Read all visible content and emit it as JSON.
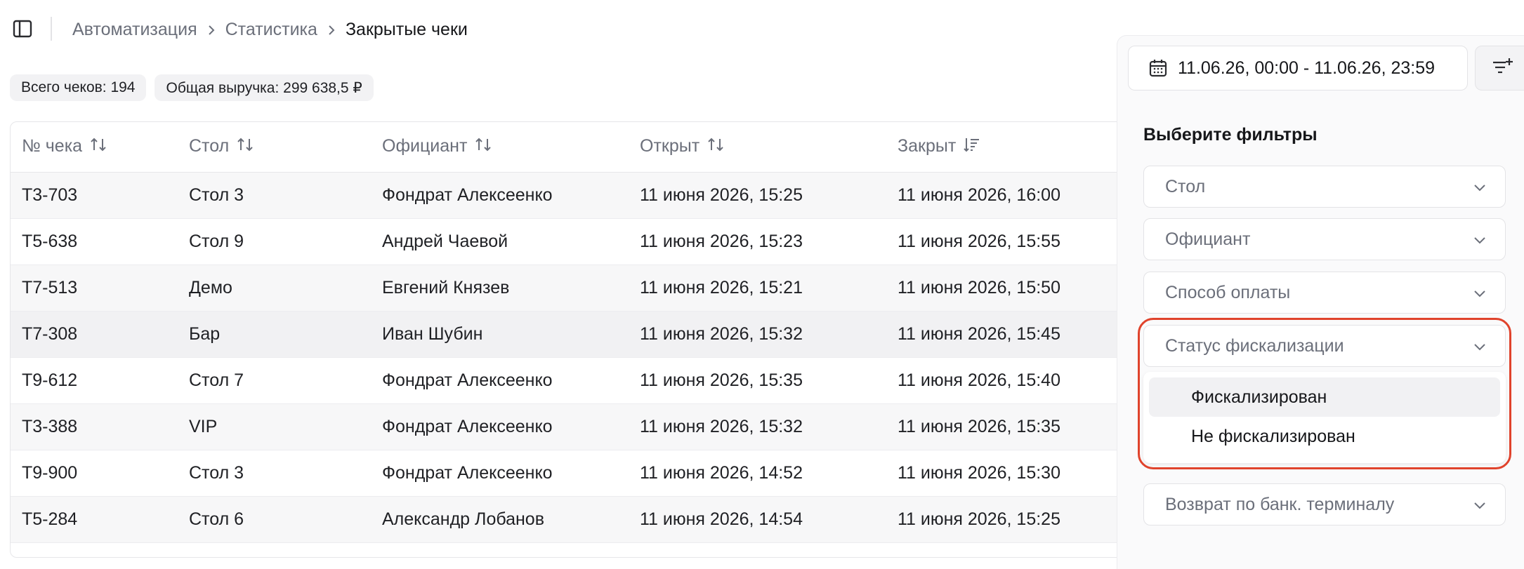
{
  "breadcrumb": [
    "Автоматизация",
    "Статистика",
    "Закрытые чеки"
  ],
  "stats": {
    "total_checks": "Всего чеков: 194",
    "total_revenue": "Общая выручка: 299 638,5 ₽"
  },
  "table": {
    "columns": [
      "№ чека",
      "Стол",
      "Официант",
      "Открыт",
      "Закрыт"
    ],
    "rows": [
      [
        "T3-703",
        "Стол 3",
        "Фондрат Алексеенко",
        "11 июня 2026, 15:25",
        "11 июня 2026, 16:00"
      ],
      [
        "T5-638",
        "Стол 9",
        "Андрей Чаевой",
        "11 июня 2026, 15:23",
        "11 июня 2026, 15:55"
      ],
      [
        "T7-513",
        "Демо",
        "Евгений Князев",
        "11 июня 2026, 15:21",
        "11 июня 2026, 15:50"
      ],
      [
        "T7-308",
        "Бар",
        "Иван Шубин",
        "11 июня 2026, 15:32",
        "11 июня 2026, 15:45"
      ],
      [
        "T9-612",
        "Стол 7",
        "Фондрат Алексеенко",
        "11 июня 2026, 15:35",
        "11 июня 2026, 15:40"
      ],
      [
        "T3-388",
        "VIP",
        "Фондрат Алексеенко",
        "11 июня 2026, 15:32",
        "11 июня 2026, 15:35"
      ],
      [
        "T9-900",
        "Стол 3",
        "Фондрат Алексеенко",
        "11 июня 2026, 14:52",
        "11 июня 2026, 15:30"
      ],
      [
        "T5-284",
        "Стол 6",
        "Александр Лобанов",
        "11 июня 2026, 14:54",
        "11 июня 2026, 15:25"
      ]
    ]
  },
  "date_range": "11.06.26, 00:00 - 11.06.26, 23:59",
  "filters": {
    "title": "Выберите фильтры",
    "table": "Стол",
    "waiter": "Официант",
    "payment_method": "Способ оплаты",
    "fiscal_status": "Статус фискализации",
    "fiscal_options": [
      "Фискализирован",
      "Не фискализирован"
    ],
    "bank_terminal_refund": "Возврат по банк. терминалу"
  },
  "colors": {
    "highlight": "#e0432c",
    "muted_text": "#6b6f7a"
  }
}
